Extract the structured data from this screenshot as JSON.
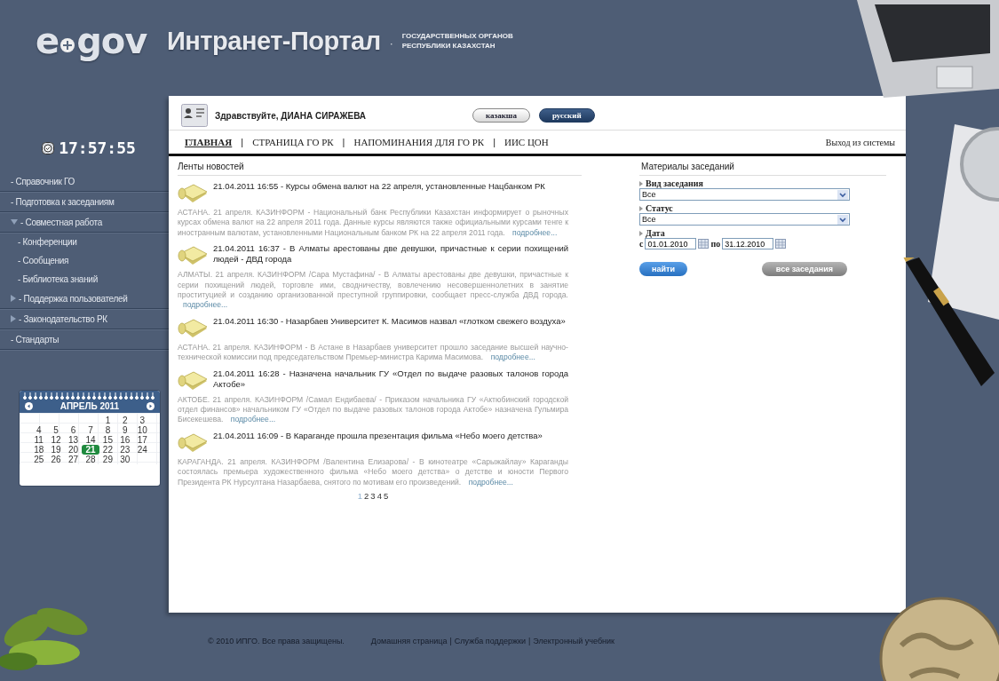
{
  "header": {
    "logo": {
      "left": "e",
      "right": "gov"
    },
    "title": "Интранет-Портал",
    "separator": "·",
    "subtitle_lines": [
      "ГОСУДАРСТВЕННЫХ ОРГАНОВ",
      "РЕСПУБЛИКИ КАЗАХСТАН"
    ]
  },
  "clock": "17:57:55",
  "sidebar": {
    "items": [
      {
        "label": "- Справочник ГО",
        "kind": "plain"
      },
      {
        "label": "- Подготовка к заседаниям",
        "kind": "plain"
      },
      {
        "label": "- Совместная работа",
        "kind": "folder",
        "expanded": true,
        "children": [
          {
            "label": "- Конференции"
          },
          {
            "label": "- Сообщения"
          },
          {
            "label": "- Библиотека знаний"
          }
        ]
      },
      {
        "label": "- Поддержка пользователей",
        "kind": "folder",
        "expanded": false
      },
      {
        "label": "- Законодательство РК",
        "kind": "folder",
        "expanded": false
      },
      {
        "label": "- Стандарты",
        "kind": "plain"
      }
    ]
  },
  "calendar": {
    "title": "АПРЕЛЬ 2011",
    "weeks": [
      {
        "kind": "partial_start",
        "days": [
          {
            "day": "1",
            "selected": false
          },
          {
            "day": "2",
            "selected": false
          },
          {
            "day": "3",
            "selected": false
          }
        ]
      },
      {
        "kind": "full",
        "days": [
          {
            "day": "4",
            "selected": false
          },
          {
            "day": "5",
            "selected": false
          },
          {
            "day": "6",
            "selected": false
          },
          {
            "day": "7",
            "selected": false
          },
          {
            "day": "8",
            "selected": false
          },
          {
            "day": "9",
            "selected": false
          },
          {
            "day": "10",
            "selected": false
          }
        ]
      },
      {
        "kind": "full",
        "days": [
          {
            "day": "11",
            "selected": false
          },
          {
            "day": "12",
            "selected": false
          },
          {
            "day": "13",
            "selected": false
          },
          {
            "day": "14",
            "selected": false
          },
          {
            "day": "15",
            "selected": false
          },
          {
            "day": "16",
            "selected": false
          },
          {
            "day": "17",
            "selected": false
          }
        ]
      },
      {
        "kind": "full",
        "days": [
          {
            "day": "18",
            "selected": false
          },
          {
            "day": "19",
            "selected": false
          },
          {
            "day": "20",
            "selected": false
          },
          {
            "day": "21",
            "selected": true
          },
          {
            "day": "22",
            "selected": false
          },
          {
            "day": "23",
            "selected": false
          },
          {
            "day": "24",
            "selected": false
          }
        ]
      },
      {
        "kind": "full",
        "days": [
          {
            "day": "25",
            "selected": false
          },
          {
            "day": "26",
            "selected": false
          },
          {
            "day": "27",
            "selected": false
          },
          {
            "day": "28",
            "selected": false
          },
          {
            "day": "29",
            "selected": false
          },
          {
            "day": "30",
            "selected": false
          }
        ]
      }
    ]
  },
  "user_bar": {
    "greeting": "Здравствуйте, ДИАНА СИРАЖЕВА",
    "languages": [
      {
        "label": "казакша",
        "selected": false
      },
      {
        "label": "русский",
        "selected": true
      }
    ]
  },
  "nav": {
    "tabs": [
      {
        "label": "ГЛАВНАЯ",
        "selected": true
      },
      {
        "label": "СТРАНИЦА ГО РК",
        "selected": false
      },
      {
        "label": "НАПОМИНАНИЯ ДЛЯ ГО РК",
        "selected": false
      },
      {
        "label": "ИИС ЦОН",
        "selected": false
      }
    ],
    "separator": "|",
    "logout": "Выход из системы"
  },
  "news": {
    "title": "Ленты новостей",
    "items": [
      {
        "headline": "21.04.2011 16:55  - Курсы обмена валют на 22 апреля, установленные Нацбанком РК",
        "summary": "АСТАНА. 21 апреля. КАЗИНФОРМ - Национальный банк Республики Казахстан информирует о рыночных курсах обмена валют на 22 апреля 2011 года. Данные курсы являются также официальными курсами тенге к иностранным валютам, установленными Национальным банком РК на 22 апреля 2011 года.",
        "more": "подробнее..."
      },
      {
        "headline": "21.04.2011 16:37  - В Алматы арестованы две девушки, причастные к серии похищений людей - ДВД города",
        "summary": "АЛМАТЫ. 21 апреля. КАЗИНФОРМ /Сара Мустафина/ - В Алматы арестованы две девушки, причастные к серии похищений людей, торговле ими, сводничеству, вовлечению несовершеннолетних в занятие проституцией и созданию организованной преступной группировки, сообщает пресс-служба ДВД города.",
        "more": "подробнее..."
      },
      {
        "headline": "21.04.2011 16:30  - Назарбаев Университет К. Масимов назвал «глотком свежего воздуха»",
        "summary": "АСТАНА. 21 апреля. КАЗИНФОРМ - В Астане в Назарбаев университет прошло заседание высшей научно-технической комиссии под председательством Премьер-министра Карима Масимова.",
        "more": "подробнее..."
      },
      {
        "headline": "21.04.2011 16:28  - Назначена начальник ГУ «Отдел по выдаче разовых талонов города Актобе»",
        "summary": "АКТОБЕ. 21 апреля. КАЗИНФОРМ /Самал Ендибаева/ - Приказом начальника ГУ «Актюбинский городской отдел финансов» начальником ГУ «Отдел по выдаче разовых талонов города Актобе» назначена Гульмира Бисекешева.",
        "more": "подробнее..."
      },
      {
        "headline": "21.04.2011 16:09  - В Караганде прошла презентация фильма «Небо моего детства»",
        "summary": "КАРАГАНДА. 21 апреля. КАЗИНФОРМ /Валентина Елизарова/ - В кинотеатре «Сарыжайлау» Караганды состоялась премьера художественного фильма «Небо моего детства» о детстве и юности Первого Президента РК Нурсултана Назарбаева, снятого по мотивам его произведений.",
        "more": "подробнее..."
      }
    ],
    "pages": [
      {
        "label": "1",
        "selected": true
      },
      {
        "label": "2",
        "selected": false
      },
      {
        "label": "3",
        "selected": false
      },
      {
        "label": "4",
        "selected": false
      },
      {
        "label": "5",
        "selected": false
      }
    ]
  },
  "materials": {
    "title": "Материалы заседаний",
    "filters": [
      {
        "kind": "select",
        "label": "Вид заседания",
        "value": "Все"
      },
      {
        "kind": "select",
        "label": "Статус",
        "value": "Все"
      },
      {
        "kind": "daterange",
        "label": "Дата",
        "from_label": "с",
        "from": "01.01.2010",
        "to_label": "по",
        "to": "31.12.2010"
      }
    ],
    "buttons": [
      {
        "label": "найти",
        "kind": "primary"
      },
      {
        "label": "все заседания",
        "kind": "secondary"
      }
    ]
  },
  "footer": {
    "copyright": "© 2010 ИПГО.  Все права защищены.",
    "links": [
      "Домашняя страница",
      "Служба поддержки",
      "Электронный учебник"
    ],
    "separator": "|"
  }
}
